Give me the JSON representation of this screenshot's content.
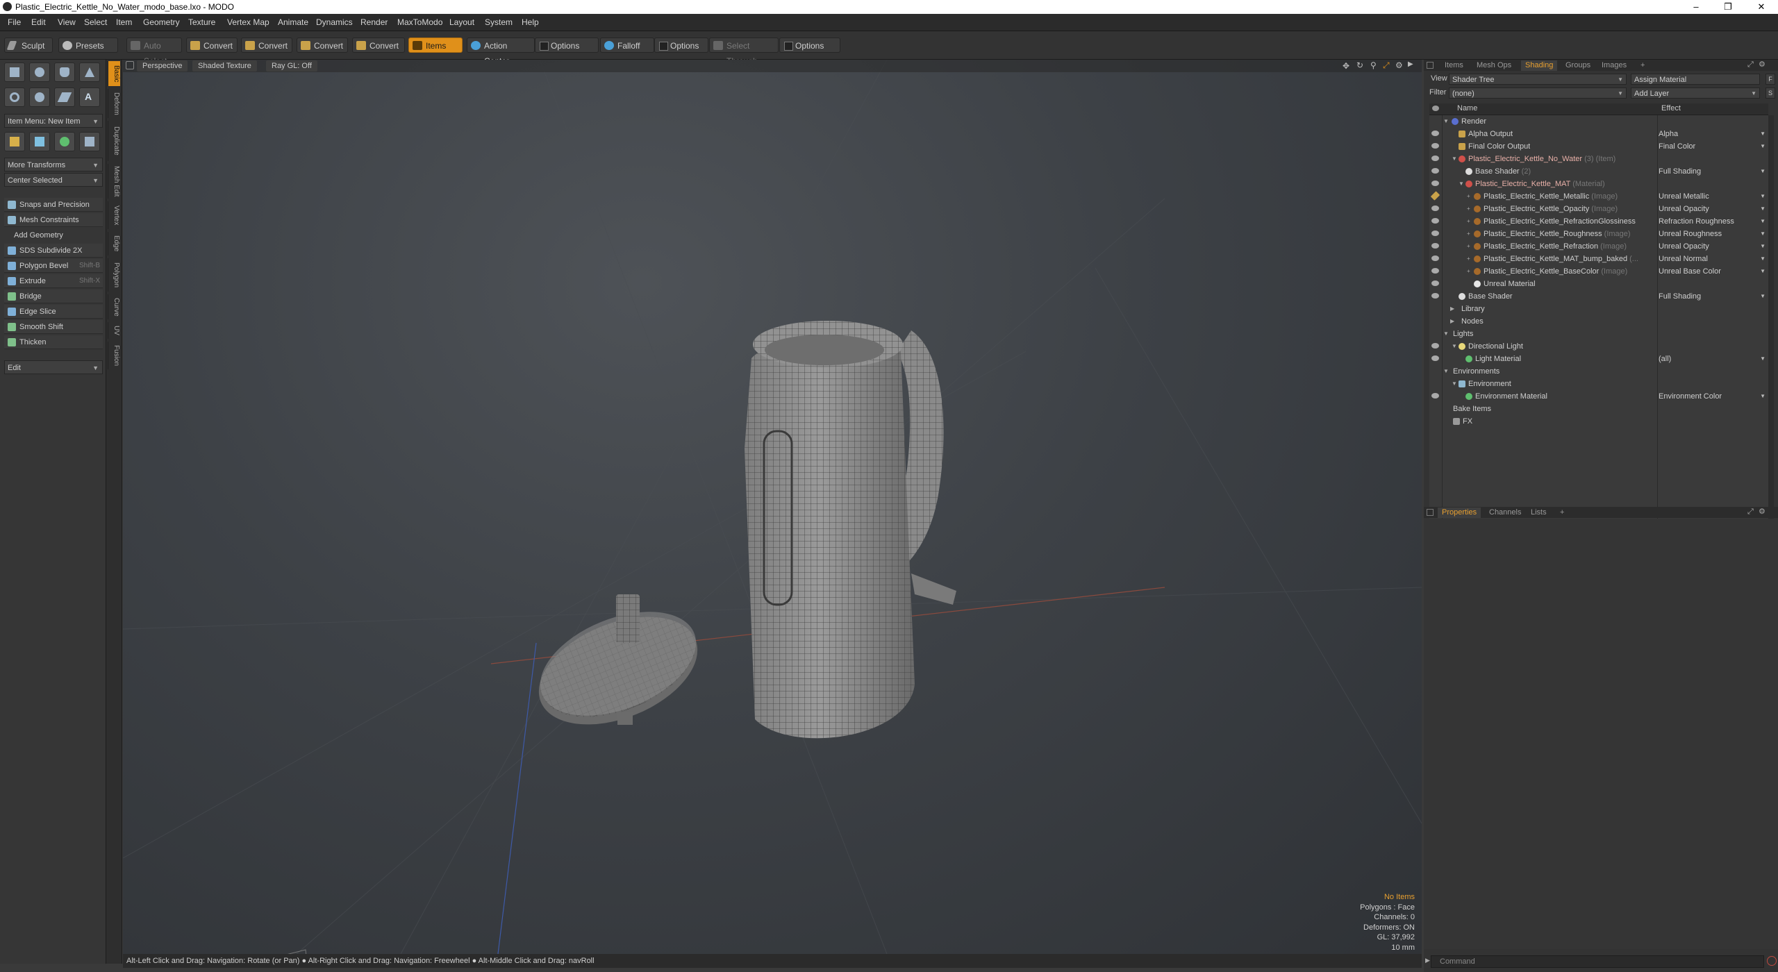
{
  "window": {
    "title": "Plastic_Electric_Kettle_No_Water_modo_base.lxo - MODO"
  },
  "menu": [
    "File",
    "Edit",
    "View",
    "Select",
    "Item",
    "Geometry",
    "Texture",
    "Vertex Map",
    "Animate",
    "Dynamics",
    "Render",
    "MaxToModo",
    "Layout",
    "System",
    "Help"
  ],
  "toolbar": {
    "sculpt": "Sculpt",
    "presets": "Presets",
    "auto_select": "Auto Select",
    "convert1": "Convert",
    "convert2": "Convert",
    "convert3": "Convert",
    "convert4": "Convert",
    "items": "Items",
    "action_center": "Action Center",
    "options1": "Options",
    "falloff": "Falloff",
    "options2": "Options",
    "select_through": "Select Through",
    "options3": "Options"
  },
  "left": {
    "item_menu": "Item Menu: New Item",
    "more_transforms": "More Transforms",
    "center_selected": "Center Selected",
    "snaps": "Snaps and Precision",
    "mesh_constraints": "Mesh Constraints",
    "add_geometry": "Add Geometry",
    "tools": [
      {
        "label": "SDS Subdivide 2X",
        "shortcut": ""
      },
      {
        "label": "Polygon Bevel",
        "shortcut": "Shift-B"
      },
      {
        "label": "Extrude",
        "shortcut": "Shift-X"
      },
      {
        "label": "Bridge",
        "shortcut": ""
      },
      {
        "label": "Edge Slice",
        "shortcut": ""
      },
      {
        "label": "Smooth Shift",
        "shortcut": ""
      },
      {
        "label": "Thicken",
        "shortcut": ""
      }
    ],
    "edit": "Edit",
    "vtabs": [
      "Basic",
      "Deform",
      "Duplicate",
      "Mesh Edit",
      "Vertex",
      "Edge",
      "Polygon",
      "Curve",
      "UV",
      "Fusion"
    ]
  },
  "viewport": {
    "perspective": "Perspective",
    "shaded": "Shaded Texture",
    "raygl": "Ray GL: Off",
    "stats": {
      "no_items": "No Items",
      "polygons": "Polygons : Face",
      "channels": "Channels: 0",
      "deformers": "Deformers: ON",
      "gl": "GL: 37,992",
      "unit": "10 mm"
    }
  },
  "statusbar": "Alt-Left Click and Drag: Navigation: Rotate (or Pan) ● Alt-Right Click and Drag: Navigation: Freewheel ● Alt-Middle Click and Drag: navRoll",
  "shading": {
    "tabs": [
      "Items",
      "Mesh Ops",
      "Shading",
      "Groups",
      "Images"
    ],
    "view_label": "View",
    "view_value": "Shader Tree",
    "assign": "Assign Material",
    "filter_label": "Filter",
    "filter_value": "(none)",
    "add_layer": "Add Layer",
    "col_name": "Name",
    "col_effect": "Effect",
    "rows": [
      {
        "name": "Render",
        "dim": "",
        "effect": ""
      },
      {
        "name": "Alpha Output",
        "dim": "",
        "effect": "Alpha"
      },
      {
        "name": "Final Color Output",
        "dim": "",
        "effect": "Final Color"
      },
      {
        "name": "Plastic_Electric_Kettle_No_Water",
        "dim": "(3) (Item)",
        "effect": ""
      },
      {
        "name": "Base Shader",
        "dim": "(2)",
        "effect": "Full Shading"
      },
      {
        "name": "Plastic_Electric_Kettle_MAT",
        "dim": "(Material)",
        "effect": ""
      },
      {
        "name": "Plastic_Electric_Kettle_Metallic",
        "dim": "(Image)",
        "effect": "Unreal Metallic"
      },
      {
        "name": "Plastic_Electric_Kettle_Opacity",
        "dim": "(Image)",
        "effect": "Unreal Opacity"
      },
      {
        "name": "Plastic_Electric_Kettle_RefractionGlossiness",
        "dim": "",
        "effect": "Refraction Roughness"
      },
      {
        "name": "Plastic_Electric_Kettle_Roughness",
        "dim": "(Image)",
        "effect": "Unreal Roughness"
      },
      {
        "name": "Plastic_Electric_Kettle_Refraction",
        "dim": "(Image)",
        "effect": "Unreal Opacity"
      },
      {
        "name": "Plastic_Electric_Kettle_MAT_bump_baked",
        "dim": "(...",
        "effect": "Unreal Normal"
      },
      {
        "name": "Plastic_Electric_Kettle_BaseColor",
        "dim": "(Image)",
        "effect": "Unreal Base Color"
      },
      {
        "name": "Unreal Material",
        "dim": "",
        "effect": ""
      },
      {
        "name": "Base Shader",
        "dim": "",
        "effect": "Full Shading"
      },
      {
        "name": "Library",
        "dim": "",
        "effect": ""
      },
      {
        "name": "Nodes",
        "dim": "",
        "effect": ""
      },
      {
        "name": "Lights",
        "dim": "",
        "effect": ""
      },
      {
        "name": "Directional Light",
        "dim": "",
        "effect": ""
      },
      {
        "name": "Light Material",
        "dim": "",
        "effect": "(all)"
      },
      {
        "name": "Environments",
        "dim": "",
        "effect": ""
      },
      {
        "name": "Environment",
        "dim": "",
        "effect": ""
      },
      {
        "name": "Environment Material",
        "dim": "",
        "effect": "Environment Color"
      },
      {
        "name": "Bake Items",
        "dim": "",
        "effect": ""
      },
      {
        "name": "FX",
        "dim": "",
        "effect": ""
      }
    ]
  },
  "properties": {
    "tabs": [
      "Properties",
      "Channels",
      "Lists"
    ]
  },
  "command": {
    "placeholder": "Command"
  }
}
